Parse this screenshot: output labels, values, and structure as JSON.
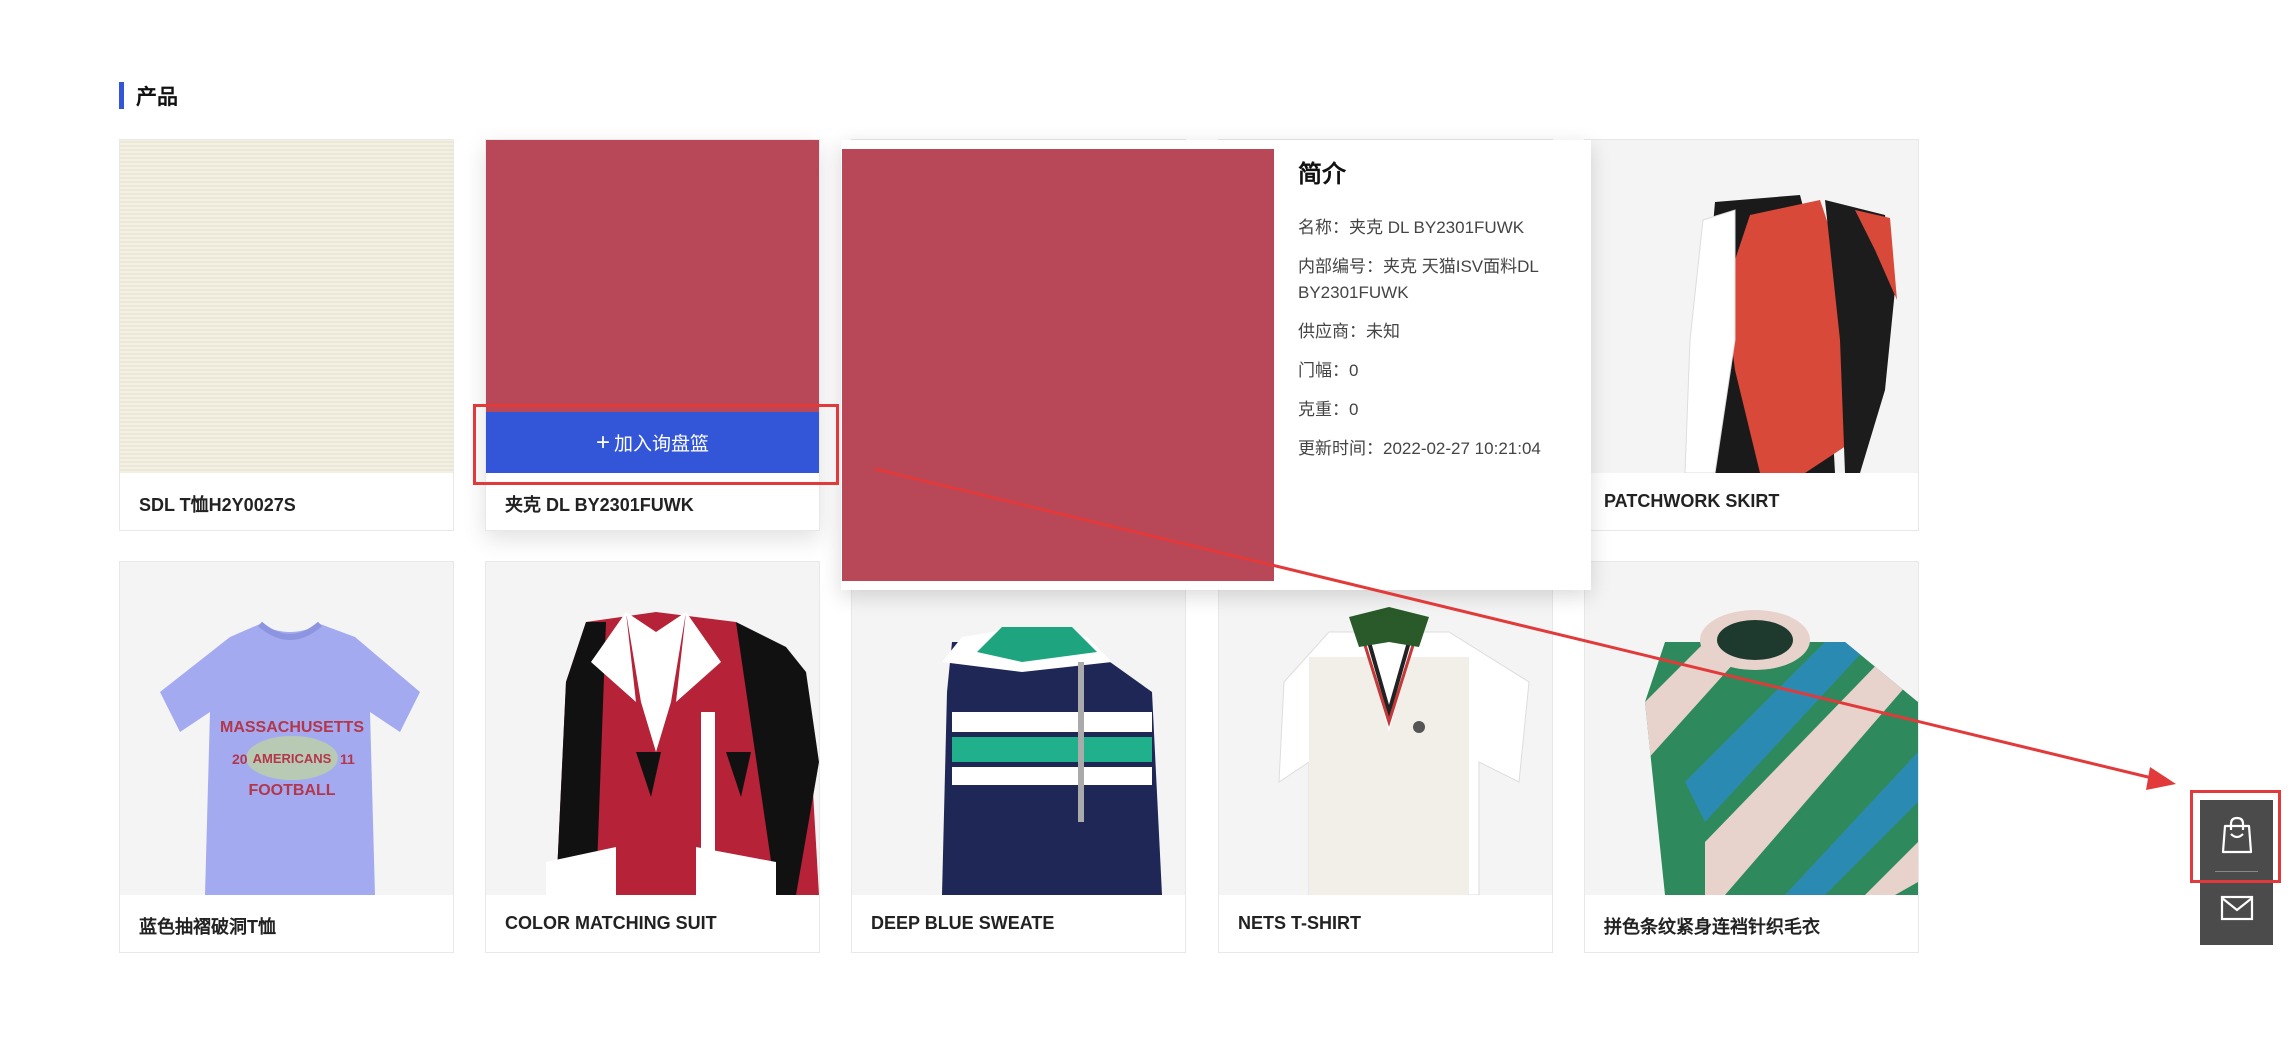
{
  "section": {
    "title": "产品"
  },
  "products": [
    {
      "name": "SDL T恤H2Y0027S"
    },
    {
      "name": "夹克 DL BY2301FUWK",
      "add_label": "加入询盘篮"
    },
    {
      "name": ""
    },
    {
      "name": ""
    },
    {
      "name": "PATCHWORK SKIRT"
    },
    {
      "name": "蓝色抽褶破洞T恤",
      "print_top": "MASSACHUSETTS",
      "print_mid": "AMERICANS",
      "print_bottom": "FOOTBALL",
      "print_left_num": "20",
      "print_right_num": "11"
    },
    {
      "name": "COLOR MATCHING SUIT"
    },
    {
      "name": "DEEP BLUE SWEATE"
    },
    {
      "name": "NETS T-SHIRT"
    },
    {
      "name": "拼色条纹紧身连裆针织毛衣"
    }
  ],
  "popover": {
    "title": "简介",
    "name_row": "名称：夹克 DL BY2301FUWK",
    "code_row": "内部编号：夹克 天猫ISV面料DL BY2301FUWK",
    "supplier_row": "供应商：未知",
    "width_row": "门幅：0",
    "weight_row": "克重：0",
    "updated_row": "更新时间：2022-02-27 10:21:04"
  },
  "colors": {
    "accent": "#3355d8",
    "swatch_red": "#b84757",
    "annotation_red": "#e23a3a",
    "side_panel": "#4b4b4b"
  },
  "icons": {
    "cart": "shopping-bag-icon",
    "mail": "mail-icon",
    "plus": "plus-icon"
  }
}
